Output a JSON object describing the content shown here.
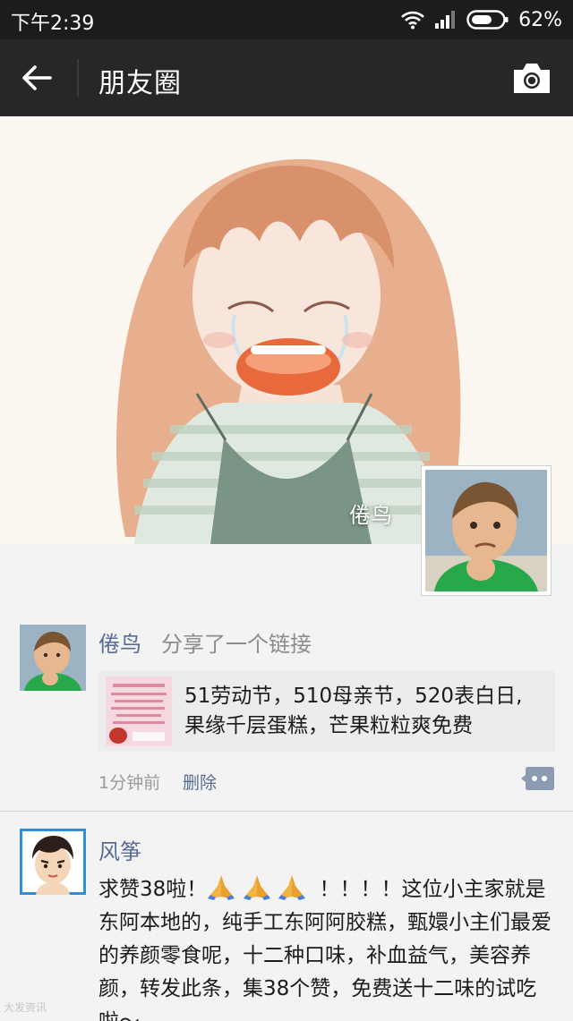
{
  "status_bar": {
    "time": "下午2:39",
    "battery": "62%",
    "icons": [
      "wifi-icon",
      "signal-icon",
      "battery-icon"
    ]
  },
  "nav": {
    "back_icon": "arrow-left-icon",
    "title": "朋友圈",
    "camera_icon": "camera-icon"
  },
  "cover": {
    "owner_name": "倦鸟"
  },
  "feed": [
    {
      "author": "倦鸟",
      "action": "分享了一个链接",
      "link_title": "51劳动节，510母亲节，520表白日,果缘千层蛋糕，芒果粒粒爽免费",
      "time": "1分钟前",
      "delete_label": "删除"
    },
    {
      "author": "风筝",
      "text_part1": "求赞38啦！",
      "text_part2": "！！！！这位小主家就是东阿本地的，纯手工东阿阿胶糕，甄嬛小主们最爱的养颜零食呢，十二种口味，补血益气，美容养颜，转发此条，集38个赞，免费送十二味的试吃啦～"
    }
  ],
  "watermark": "大发资讯",
  "colors": {
    "status_bar": "#1c1c1c",
    "nav_bar": "#272727",
    "link_blue": "#576b95",
    "feed_bg": "#f3f3f4"
  }
}
